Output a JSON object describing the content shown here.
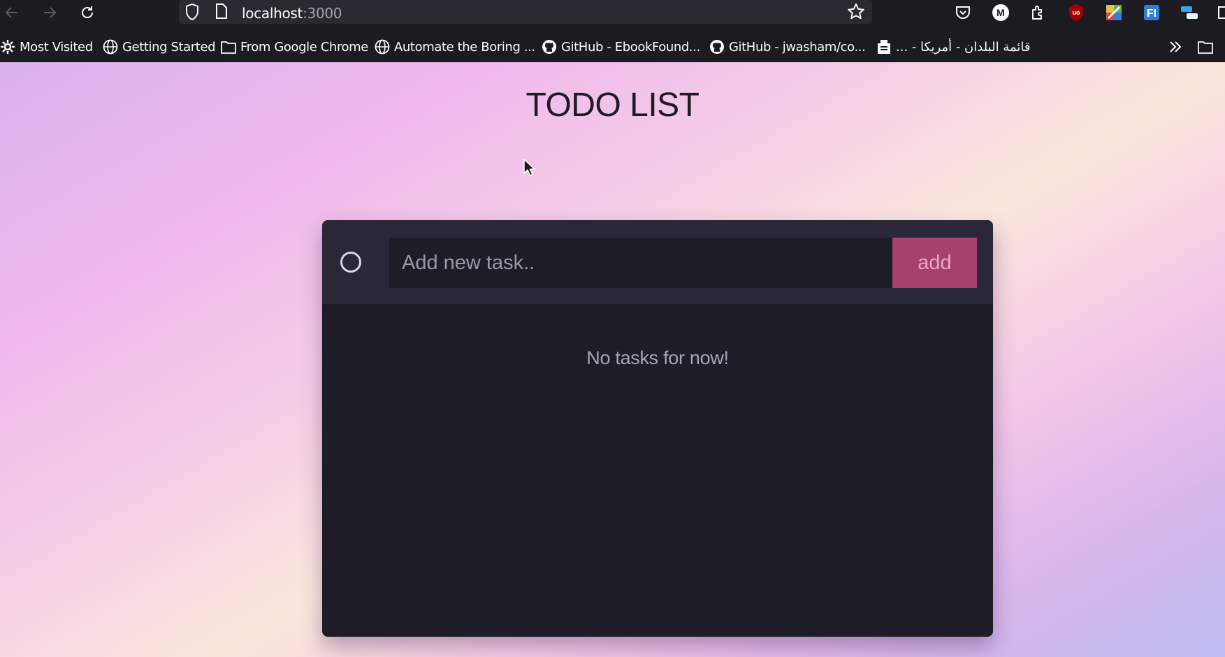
{
  "browser": {
    "url_host": "localhost",
    "url_port": ":3000",
    "bookmarks": [
      {
        "label": "Most Visited",
        "icon": "gear-icon"
      },
      {
        "label": "Getting Started",
        "icon": "globe-icon"
      },
      {
        "label": "From Google Chrome",
        "icon": "folder-icon"
      },
      {
        "label": "Automate the Boring ...",
        "icon": "globe-icon"
      },
      {
        "label": "GitHub - EbookFound...",
        "icon": "github-icon"
      },
      {
        "label": "GitHub - jwasham/co...",
        "icon": "github-icon"
      },
      {
        "label": "قائمة البلدان - أمريكا - ...",
        "icon": "page-icon"
      }
    ],
    "extensions": [
      "pocket-icon",
      "m-extension-icon",
      "puzzle-icon",
      "ublock-icon",
      "color-extension-icon",
      "f-extension-icon",
      "translate-icon"
    ]
  },
  "app": {
    "title": "TODO LIST",
    "input_placeholder": "Add new task..",
    "add_label": "add",
    "empty_message": "No tasks for now!"
  },
  "colors": {
    "card": "#1e1c26",
    "card_header": "#2a2837",
    "accent": "#a8406e"
  }
}
